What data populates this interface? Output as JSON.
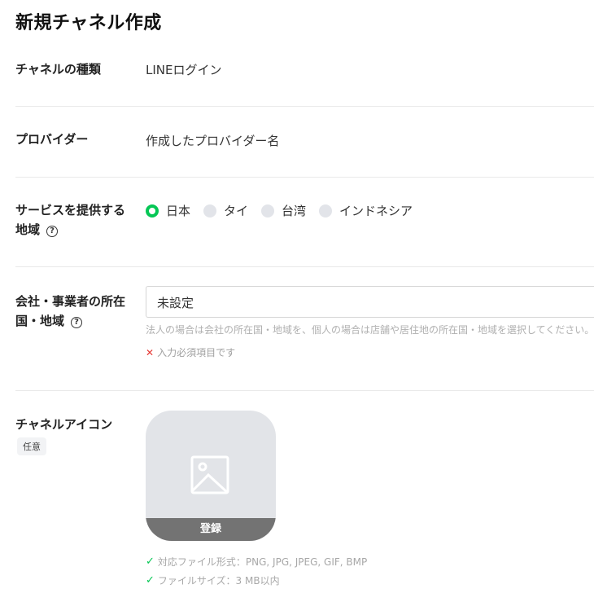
{
  "page": {
    "title": "新規チャネル作成"
  },
  "channel_type": {
    "label": "チャネルの種類",
    "value": "LINEログイン"
  },
  "provider": {
    "label": "プロバイダー",
    "value": "作成したプロバイダー名"
  },
  "region": {
    "label_line1": "サービスを提供する",
    "label_line2": "地域",
    "options": [
      {
        "label": "日本",
        "checked": true
      },
      {
        "label": "タイ",
        "checked": false
      },
      {
        "label": "台湾",
        "checked": false
      },
      {
        "label": "インドネシア",
        "checked": false
      }
    ]
  },
  "company_country": {
    "label_line1": "会社・事業者の所在",
    "label_line2": "国・地域",
    "selected": "未設定",
    "hint": "法人の場合は会社の所在国・地域を、個人の場合は店舗や居住地の所在国・地域を選択してください。",
    "error": "入力必須項目です"
  },
  "channel_icon": {
    "label": "チャネルアイコン",
    "badge": "任意",
    "register_label": "登録",
    "requirements": [
      "対応ファイル形式：PNG, JPG, JPEG, GIF, BMP",
      "ファイルサイズ：3 MB以内"
    ]
  },
  "help_glyph": "?",
  "error_glyph": "✕",
  "check_glyph": "✓",
  "colors": {
    "accent_green": "#06c755",
    "error_red": "#e53935"
  }
}
